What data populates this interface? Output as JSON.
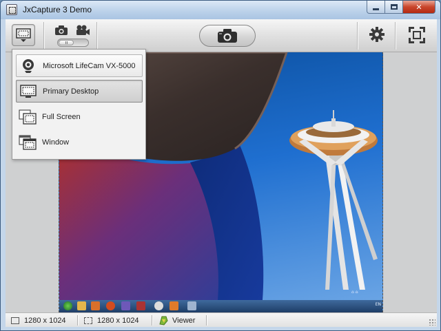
{
  "window": {
    "title": "JxCapture 3 Demo",
    "icon": "jxcapture-app-icon",
    "controls": {
      "minimize_icon": "minimize-icon",
      "maximize_icon": "maximize-icon",
      "close_glyph": "✕"
    }
  },
  "toolbar": {
    "source_selector_icon": "monitor-dropdown-icon",
    "mode_icons": [
      "photo-camera-icon",
      "video-camera-icon"
    ],
    "mode_toggle": "photo",
    "capture_button_icon": "camera-icon",
    "settings_icon": "gear-icon",
    "fit_icon": "fit-to-window-icon"
  },
  "source_menu": {
    "items": [
      {
        "label": "Microsoft LifeCam VX-5000",
        "icon": "webcam-icon",
        "state": "boxed"
      },
      {
        "label": "Primary Desktop",
        "icon": "monitor-icon",
        "state": "selected"
      },
      {
        "label": "Full Screen",
        "icon": "full-screen-icon",
        "state": "normal"
      },
      {
        "label": "Window",
        "icon": "window-icon",
        "state": "normal"
      }
    ]
  },
  "preview": {
    "taskbar_tray_text": "EN"
  },
  "statusbar": {
    "image_size": "1280 x 1024",
    "selection_size": "1280 x 1024",
    "viewer_label": "Viewer"
  },
  "colors": {
    "titlebar": "#bcd2ea",
    "close_button": "#c9462c",
    "toolbar": "#e1e1e1",
    "menu_bg": "#f2f2f2",
    "sky": "#1f6fd0"
  }
}
